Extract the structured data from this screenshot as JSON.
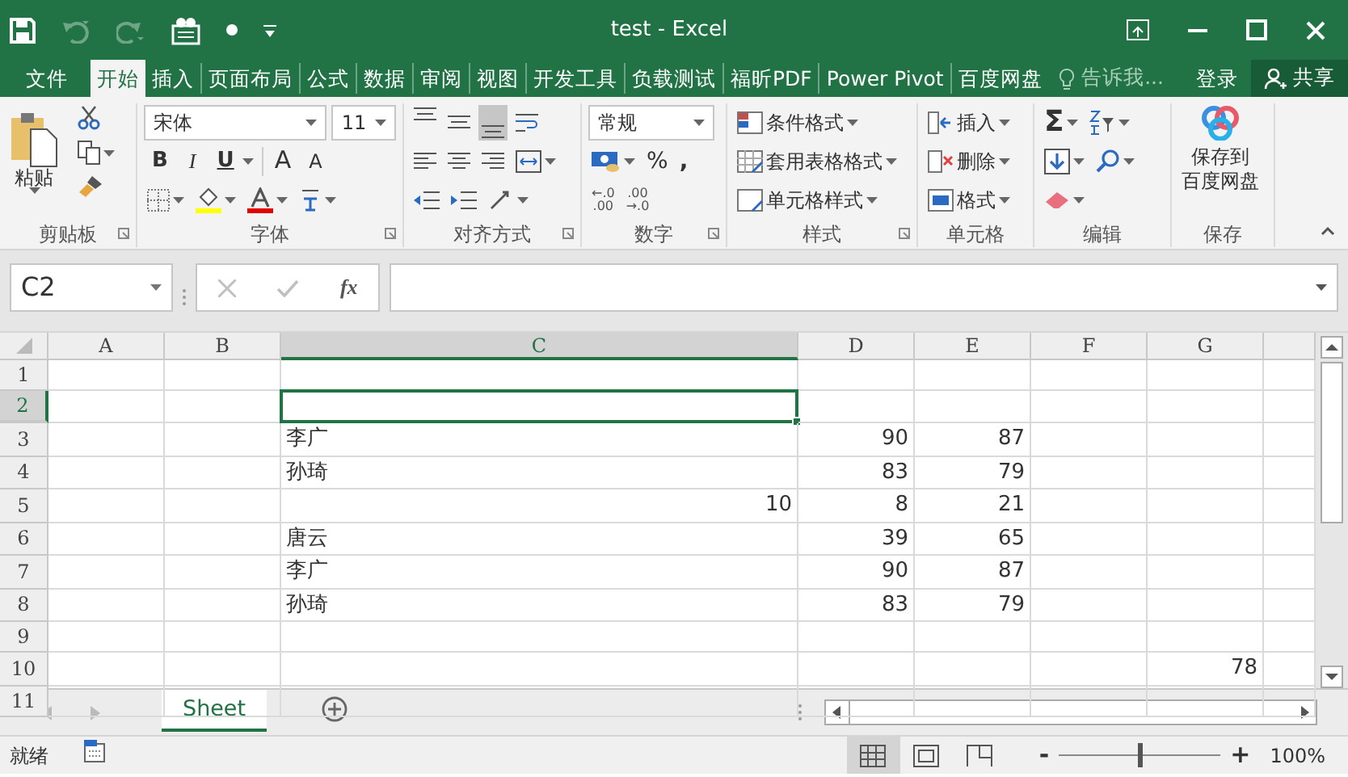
{
  "title_bar": {
    "quick_access": [
      {
        "kind": "save",
        "disabled": false
      },
      {
        "kind": "undo",
        "disabled": true
      },
      {
        "kind": "redo",
        "disabled": true
      },
      {
        "kind": "form",
        "disabled": false
      },
      {
        "kind": "dot",
        "disabled": false
      },
      {
        "kind": "customize",
        "disabled": false
      }
    ],
    "title": "test - Excel"
  },
  "ribbon_tabs": [
    {
      "label": "文件",
      "selected": false
    },
    {
      "label": "开始",
      "selected": true
    },
    {
      "label": "插入",
      "selected": false
    },
    {
      "label": "页面布局",
      "selected": false
    },
    {
      "label": "公式",
      "selected": false
    },
    {
      "label": "数据",
      "selected": false
    },
    {
      "label": "审阅",
      "selected": false
    },
    {
      "label": "视图",
      "selected": false
    },
    {
      "label": "开发工具",
      "selected": false
    },
    {
      "label": "负载测试",
      "selected": false
    },
    {
      "label": "福昕PDF",
      "selected": false
    },
    {
      "label": "Power Pivot",
      "selected": false
    },
    {
      "label": "百度网盘",
      "selected": false
    }
  ],
  "tell_me": {
    "placeholder": "告诉我..."
  },
  "sign_in": "登录",
  "share": "共享",
  "ribbon": {
    "clipboard": {
      "paste": "粘贴",
      "label": "剪贴板"
    },
    "font": {
      "font_name": "宋体",
      "font_size": "11",
      "style_buttons": [
        "B",
        "I",
        "U"
      ],
      "size_buttons": [
        "A",
        "A"
      ],
      "label": "字体"
    },
    "alignment": {
      "vertical": [
        {
          "kind": "top",
          "selected": false
        },
        {
          "kind": "middle",
          "selected": false
        },
        {
          "kind": "bottom",
          "selected": true
        }
      ],
      "label": "对齐方式"
    },
    "number": {
      "format": "常规",
      "symbols": [
        "%",
        ","
      ],
      "decimal_buttons": [
        [
          "←.0",
          ".00"
        ],
        [
          ".00",
          "→.0"
        ]
      ],
      "label": "数字"
    },
    "styles": {
      "items": [
        "条件格式",
        "套用表格格式",
        "单元格样式"
      ],
      "label": "样式"
    },
    "cells": {
      "items": [
        "插入",
        "删除",
        "格式"
      ],
      "label": "单元格"
    },
    "editing": {
      "sum": "Σ",
      "label": "编辑"
    },
    "save": {
      "lines": [
        "保存到",
        "百度网盘"
      ],
      "label": "保存"
    }
  },
  "formula_bar": {
    "name_box": "C2",
    "buttons": [
      {
        "kind": "cancel",
        "disabled": true
      },
      {
        "kind": "enter",
        "disabled": true
      }
    ],
    "function_label": "fx"
  },
  "sheet": {
    "columns": [
      {
        "label": "A",
        "selected": false
      },
      {
        "label": "B",
        "selected": false
      },
      {
        "label": "C",
        "selected": true
      },
      {
        "label": "D",
        "selected": false
      },
      {
        "label": "E",
        "selected": false
      },
      {
        "label": "F",
        "selected": false
      },
      {
        "label": "G",
        "selected": false
      }
    ],
    "rows": [
      {
        "label": "1",
        "selected": false,
        "cells": [
          null,
          null,
          null,
          null,
          null,
          null,
          null
        ]
      },
      {
        "label": "2",
        "selected": true,
        "cells": [
          null,
          null,
          null,
          null,
          null,
          null,
          null
        ]
      },
      {
        "label": "3",
        "selected": false,
        "cells": [
          null,
          null,
          {
            "value": "李广",
            "right_aligned": false
          },
          {
            "value": "90",
            "right_aligned": true
          },
          {
            "value": "87",
            "right_aligned": true
          },
          null,
          null
        ]
      },
      {
        "label": "4",
        "selected": false,
        "cells": [
          null,
          null,
          {
            "value": "孙琦",
            "right_aligned": false
          },
          {
            "value": "83",
            "right_aligned": true
          },
          {
            "value": "79",
            "right_aligned": true
          },
          null,
          null
        ]
      },
      {
        "label": "5",
        "selected": false,
        "cells": [
          null,
          null,
          {
            "value": "10",
            "right_aligned": true
          },
          {
            "value": "8",
            "right_aligned": true
          },
          {
            "value": "21",
            "right_aligned": true
          },
          null,
          null
        ]
      },
      {
        "label": "6",
        "selected": false,
        "cells": [
          null,
          null,
          {
            "value": "唐云",
            "right_aligned": false
          },
          {
            "value": "39",
            "right_aligned": true
          },
          {
            "value": "65",
            "right_aligned": true
          },
          null,
          null
        ]
      },
      {
        "label": "7",
        "selected": false,
        "cells": [
          null,
          null,
          {
            "value": "李广",
            "right_aligned": false
          },
          {
            "value": "90",
            "right_aligned": true
          },
          {
            "value": "87",
            "right_aligned": true
          },
          null,
          null
        ]
      },
      {
        "label": "8",
        "selected": false,
        "cells": [
          null,
          null,
          {
            "value": "孙琦",
            "right_aligned": false
          },
          {
            "value": "83",
            "right_aligned": true
          },
          {
            "value": "79",
            "right_aligned": true
          },
          null,
          null
        ]
      },
      {
        "label": "9",
        "selected": false,
        "cells": [
          null,
          null,
          null,
          null,
          null,
          null,
          null
        ]
      },
      {
        "label": "10",
        "selected": false,
        "cells": [
          null,
          null,
          null,
          null,
          null,
          null,
          {
            "value": "78",
            "right_aligned": true
          }
        ]
      },
      {
        "label": "11",
        "selected": false,
        "cells": [
          null,
          null,
          null,
          null,
          null,
          null,
          null
        ]
      }
    ]
  },
  "sheet_tabs": [
    {
      "label": "Sheet",
      "selected": true
    }
  ],
  "status_bar": {
    "status": "就绪",
    "views": [
      {
        "kind": "normal",
        "selected": true
      },
      {
        "kind": "page_layout",
        "selected": false
      },
      {
        "kind": "page_break",
        "selected": false
      }
    ],
    "zoom_out": "-",
    "zoom": {
      "level": 0.5
    },
    "zoom_in": "+",
    "zoom_label": "100%"
  }
}
